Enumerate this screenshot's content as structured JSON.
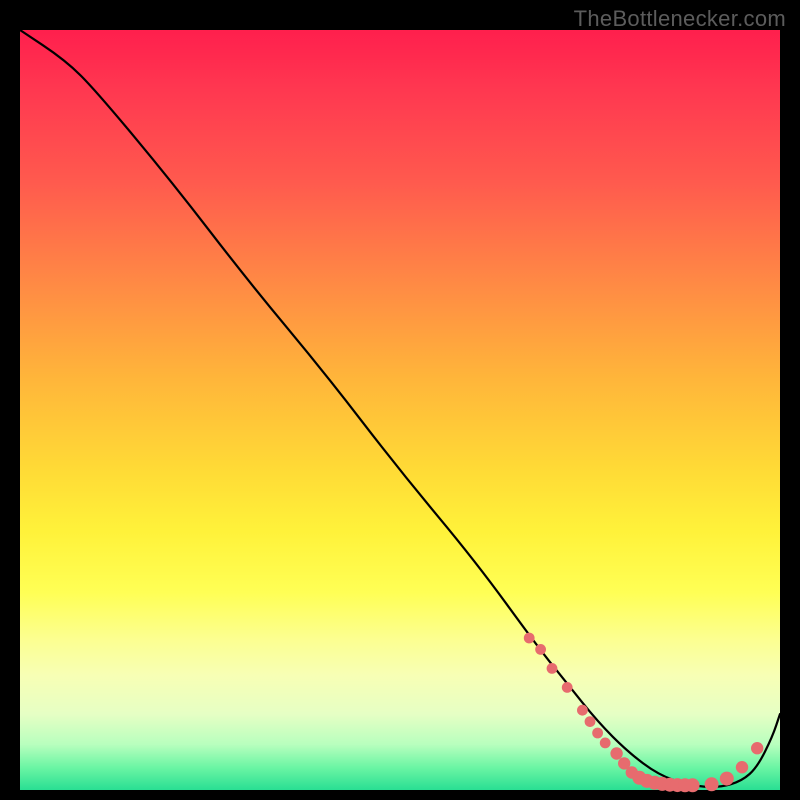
{
  "watermark": "TheBottlenecker.com",
  "chart_data": {
    "type": "line",
    "title": "",
    "xlabel": "",
    "ylabel": "",
    "xlim": [
      0,
      100
    ],
    "ylim": [
      0,
      100
    ],
    "series": [
      {
        "name": "curve",
        "x": [
          0,
          6,
          10,
          20,
          30,
          40,
          50,
          60,
          68,
          72,
          76,
          80,
          84,
          88,
          92,
          95,
          97,
          99,
          100
        ],
        "y": [
          100,
          96,
          92,
          80,
          67,
          55,
          42,
          30,
          19,
          14,
          9,
          5,
          2,
          0.6,
          0.3,
          1.2,
          3,
          7,
          10
        ]
      }
    ],
    "markers": {
      "name": "highlight-points",
      "color": "#e76b6e",
      "x": [
        67,
        68.5,
        70,
        72,
        74,
        75,
        76,
        77,
        78.5,
        79.5,
        80.5,
        81.5,
        82.5,
        83.5,
        84.5,
        85.5,
        86.5,
        87.5,
        88.5,
        91,
        93,
        95,
        97
      ],
      "y": [
        20,
        18.5,
        16,
        13.5,
        10.5,
        9,
        7.5,
        6.2,
        4.8,
        3.5,
        2.3,
        1.6,
        1.2,
        0.95,
        0.8,
        0.7,
        0.65,
        0.62,
        0.62,
        0.75,
        1.5,
        3.0,
        5.5
      ]
    }
  }
}
